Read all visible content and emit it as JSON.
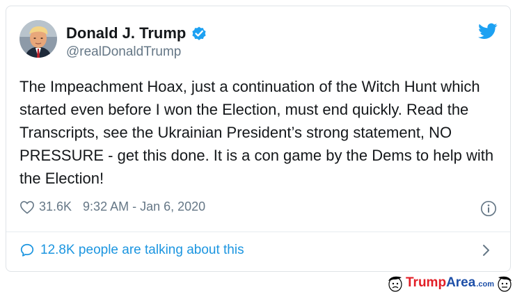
{
  "author": {
    "display_name": "Donald J. Trump",
    "handle": "@realDonaldTrump",
    "avatar_icon": "profile-photo",
    "verified_icon": "verified-badge-icon"
  },
  "tweet": {
    "text": "The Impeachment Hoax, just a continuation of the Witch Hunt which started even before I won the Election, must end quickly. Read the Transcripts, see the Ukrainian President’s strong statement, NO PRESSURE - get this done. It is a con game by the Dems to help with the Election!"
  },
  "meta": {
    "likes": "31.6K",
    "timestamp": "9:32 AM - Jan 6, 2020"
  },
  "talk": {
    "label": "12.8K people are talking about this"
  },
  "watermark": {
    "brand_part1": "Trump",
    "brand_part2": "Area",
    "brand_tld": ".com"
  },
  "colors": {
    "accent": "#1da1f2",
    "link": "#1b95e0",
    "secondary_text": "#657786",
    "watermark_red": "#e21e26",
    "watermark_blue": "#1d4fa8"
  }
}
